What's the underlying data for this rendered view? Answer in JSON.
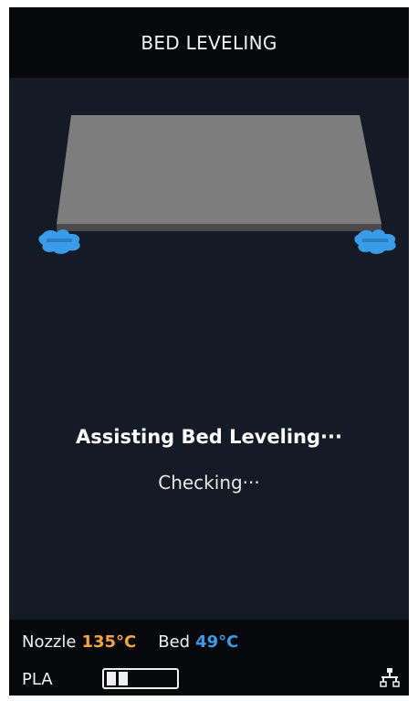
{
  "header": {
    "title": "BED LEVELING"
  },
  "status": {
    "title": "Assisting Bed Leveling···",
    "subtitle": "Checking···"
  },
  "footer": {
    "nozzle_label": "Nozzle",
    "nozzle_temp": "135°C",
    "bed_label": "Bed",
    "bed_temp": "49°C",
    "material": "PLA",
    "filament_level": 0.25,
    "network_icon": "wired-network-icon"
  },
  "colors": {
    "background": "#141b26",
    "bars": "#06080b",
    "nozzle_accent": "#f2a541",
    "bed_accent": "#3a9be6",
    "knob": "#3a9be6",
    "plate": "#7d7d7d"
  }
}
